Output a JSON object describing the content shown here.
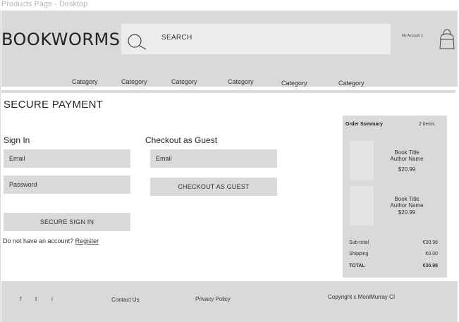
{
  "frame_label": "Products Page - Desktop",
  "header": {
    "logo": "BOOKWORMS",
    "search_label": "SEARCH",
    "account_label": "My Account v",
    "categories": [
      "Category",
      "Category",
      "Category",
      "Category",
      "Category",
      "Category"
    ]
  },
  "page_title": "SECURE PAYMENT",
  "sign_in": {
    "title": "Sign In",
    "email_placeholder": "Email",
    "password_placeholder": "Password",
    "button": "SECURE SIGN IN",
    "no_account_text": "Do not have an account?",
    "register_link": "Register"
  },
  "guest": {
    "title": "Checkout as Guest",
    "email_placeholder": "Email",
    "button": "CHECKOUT AS GUEST"
  },
  "order_summary": {
    "title": "Order Summary",
    "count": "2 items",
    "items": [
      {
        "title": "Book Title",
        "author": "Author Name",
        "price": "$20.99"
      },
      {
        "title": "Book Title",
        "author": "Author Name",
        "price": "$20.99"
      }
    ],
    "subtotal_label": "Sub-total",
    "subtotal_value": "€30.98",
    "shipping_label": "Shipping",
    "shipping_value": "€0.00",
    "total_label": "TOTAL",
    "total_value": "€30.98"
  },
  "footer": {
    "social": [
      "f",
      "t",
      "i"
    ],
    "contact": "Contact Us",
    "privacy": "Privacy Policy",
    "copyright": "Copyright c MoniMurray CI"
  }
}
